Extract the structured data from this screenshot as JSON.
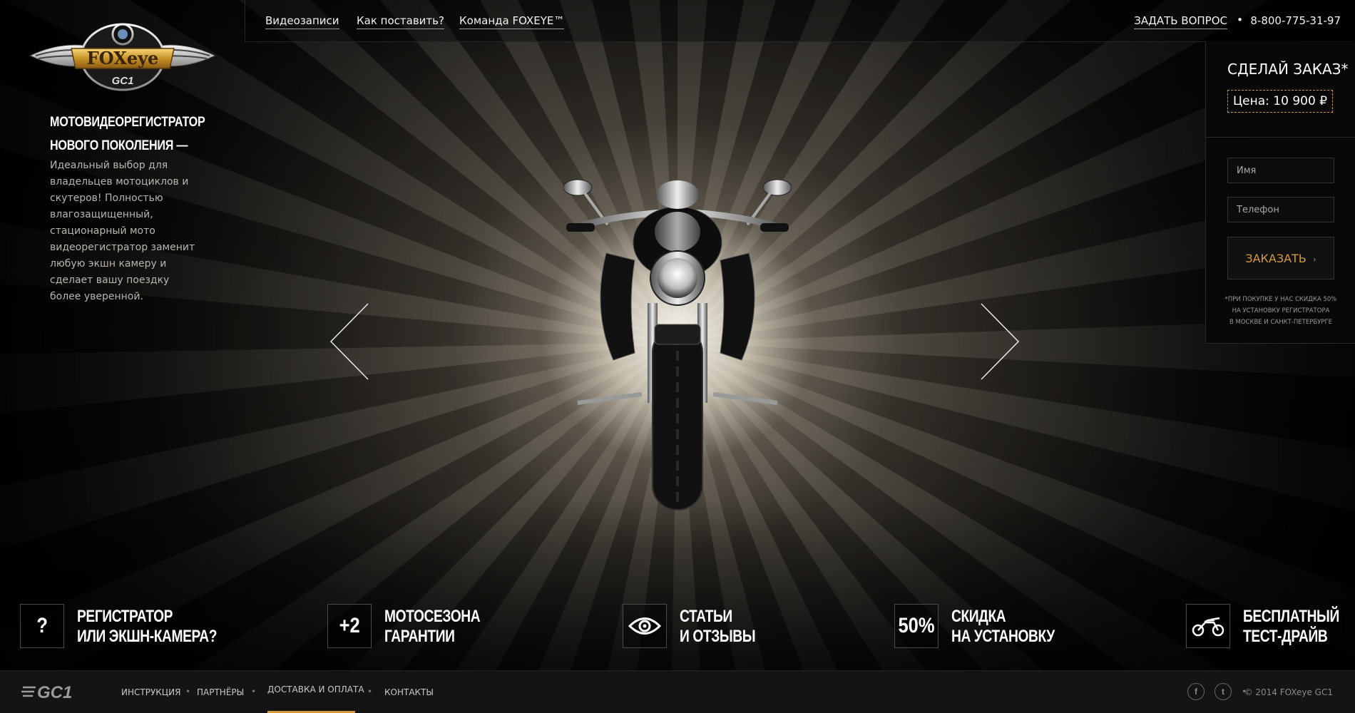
{
  "brand": {
    "logo_text": "FOXeye",
    "logo_sub": "GC1"
  },
  "nav": [
    {
      "label": "Видеозаписи"
    },
    {
      "label": "Как поставить?"
    },
    {
      "label": "Команда FOXEYE™"
    }
  ],
  "header": {
    "ask_label": "Задать вопрос",
    "separator": "•",
    "phone": "8-800-775-31-97"
  },
  "tagline": {
    "title_line1": "Мотовидеорегистратор",
    "title_line2": "нового поколения —",
    "description": "Идеальный выбор для владельцев мотоциклов и скутеров! Полностью влагозащищенный, стационарный мото видеорегистратор заменит любую экшн камеру и сделает вашу поездку более уверенной."
  },
  "order": {
    "title": "Сделай заказ*",
    "price": "Цена: 10 900 ₽",
    "name_placeholder": "Имя",
    "phone_placeholder": "Телефон",
    "submit_label": "Заказать",
    "note_line1": "*при покупке у нас скидка 50%",
    "note_line2": "на установку регистратора",
    "note_line3": "в Москве и Санкт-Петербурге"
  },
  "features": [
    {
      "icon_text": "?",
      "line1": "Регистратор",
      "line2": "или экшн-камера?"
    },
    {
      "icon_text": "+2",
      "line1": "Мотосезона",
      "line2": "гарантии"
    },
    {
      "icon": "eye-icon",
      "line1": "Статьи",
      "line2": "и отзывы"
    },
    {
      "icon_text": "50%",
      "line1": "Скидка",
      "line2": "на установку"
    },
    {
      "icon": "motorcycle-icon",
      "line1": "Бесплатный",
      "line2": "тест-драйв"
    }
  ],
  "footer": {
    "logo_text": "GC1",
    "links": [
      {
        "label": "Инструкция"
      },
      {
        "label": "Партнёры"
      },
      {
        "label": "Доставка и оплата"
      },
      {
        "label": "Контакты"
      }
    ],
    "dot": "•",
    "social_facebook": "f",
    "social_twitter": "t",
    "copyright": "© 2014 FOXeye GC1"
  },
  "colors": {
    "accent": "#d49a3a",
    "background": "#0b0a09",
    "footer": "#141414"
  }
}
